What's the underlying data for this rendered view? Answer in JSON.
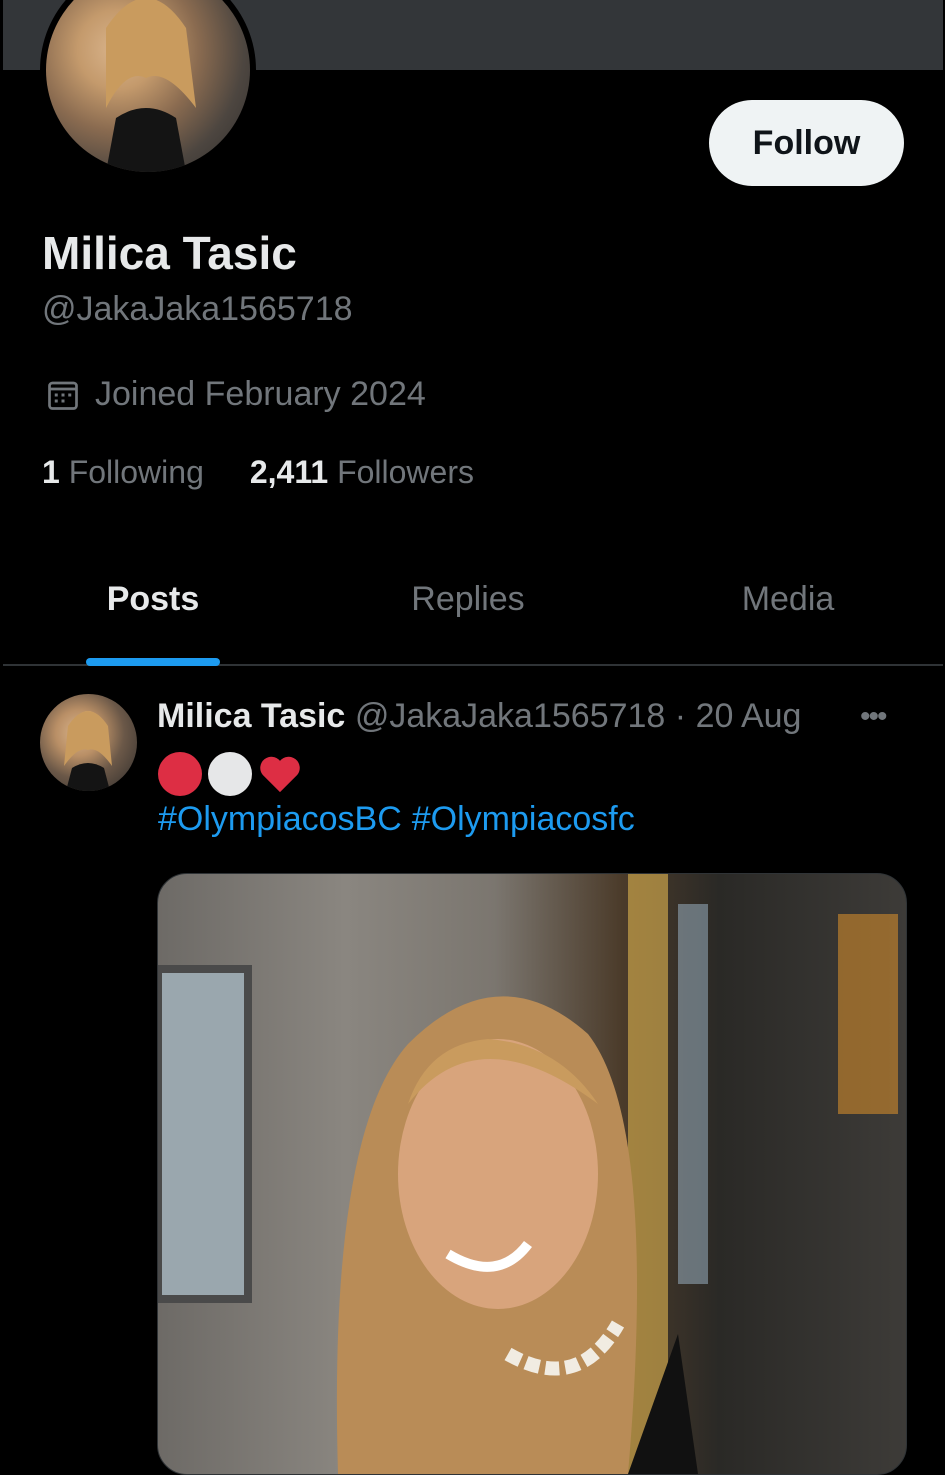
{
  "profile": {
    "display_name": "Milica Tasic",
    "handle": "@JakaJaka1565718",
    "joined": "Joined February 2024",
    "following_count": "1",
    "following_label": "Following",
    "followers_count": "2,411",
    "followers_label": "Followers",
    "follow_label": "Follow"
  },
  "tabs": [
    {
      "label": "Posts",
      "active": true
    },
    {
      "label": "Replies",
      "active": false
    },
    {
      "label": "Media",
      "active": false
    }
  ],
  "post": {
    "author_name": "Milica Tasic",
    "author_handle": "@JakaJaka1565718",
    "separator": "·",
    "date": "20 Aug",
    "more_label": "•••",
    "emoji": [
      "red-circle",
      "white-circle",
      "red-heart"
    ],
    "hashtags": [
      "#OlympiacosBC",
      "#Olympiacosfc"
    ]
  },
  "colors": {
    "accent": "#1d9bf0",
    "background": "#000000",
    "text": "#e7e9ea",
    "muted": "#71767b"
  }
}
